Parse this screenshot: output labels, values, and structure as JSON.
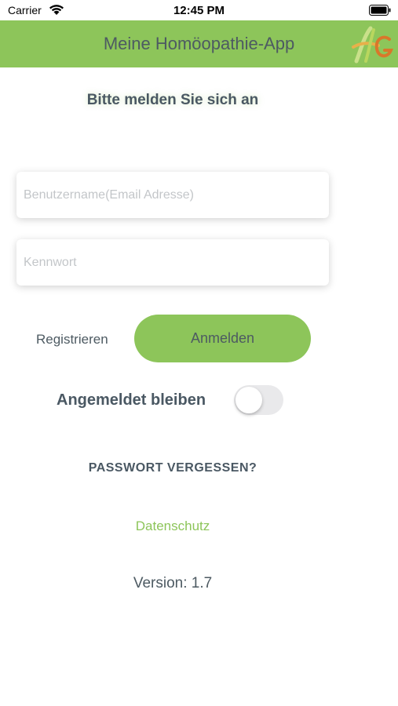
{
  "status_bar": {
    "carrier": "Carrier",
    "time": "12:45 PM",
    "wifi_icon": "wifi-icon",
    "battery_icon": "battery-icon"
  },
  "header": {
    "title": "Meine Homöopathie-App",
    "logo_icon": "app-logo-icon",
    "background_color": "#8dc55a"
  },
  "login": {
    "heading": "Bitte melden Sie sich an",
    "username_placeholder": "Benutzername(Email Adresse)",
    "username_value": "",
    "password_placeholder": "Kennwort",
    "password_value": "",
    "register_label": "Registrieren",
    "login_label": "Anmelden",
    "stay_logged_in_label": "Angemeldet bleiben",
    "stay_logged_in": false,
    "forgot_password_label": "PASSWORT VERGESSEN?",
    "privacy_label": "Datenschutz",
    "version": "Version: 1.7"
  },
  "colors": {
    "accent": "#8dc55a",
    "text": "#4a5863"
  }
}
